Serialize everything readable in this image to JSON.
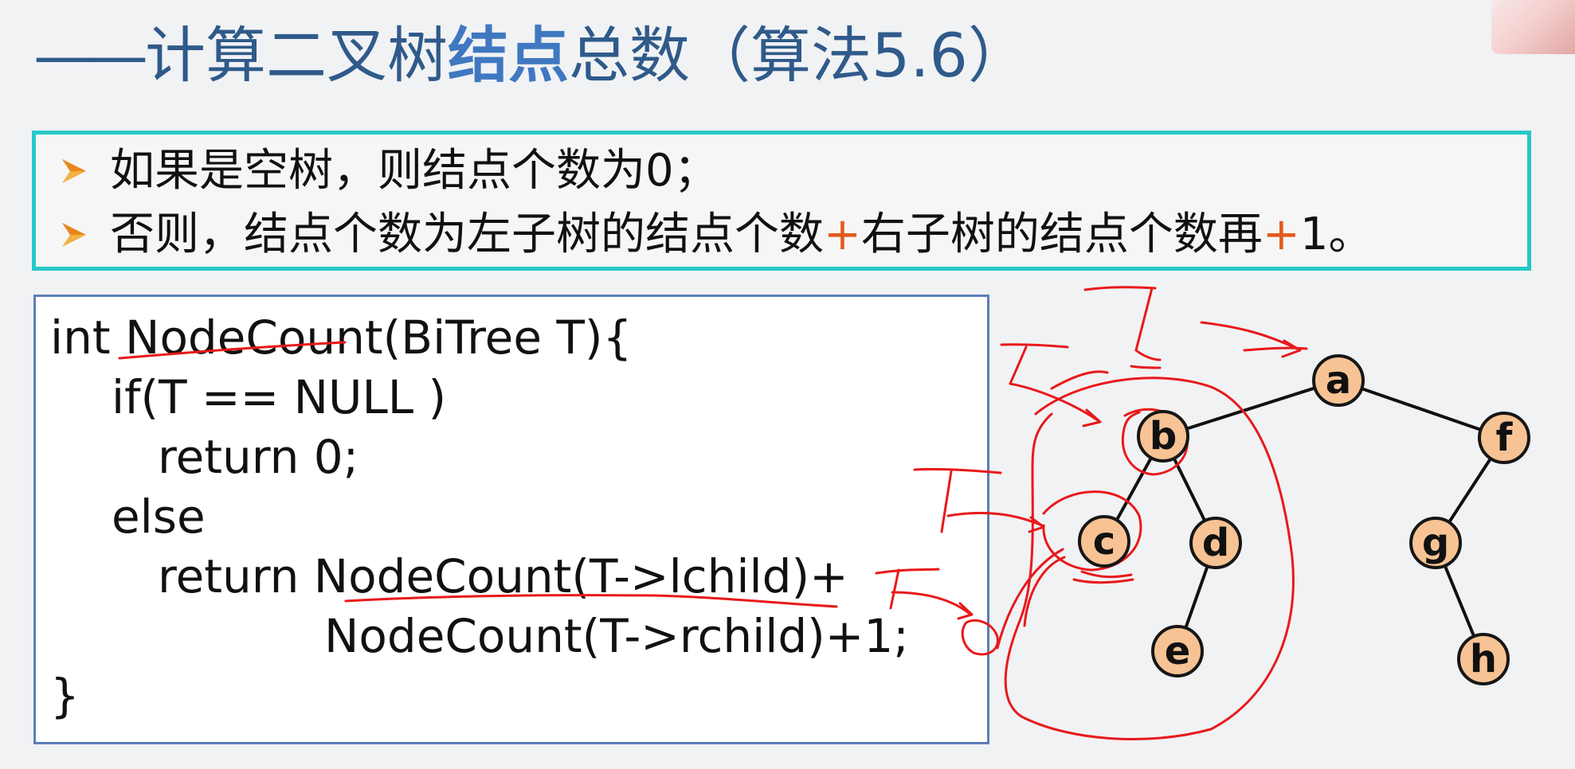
{
  "title": {
    "dash": "——",
    "prefix": "计算二叉树",
    "bold": "结点",
    "suffix": "总数（算法5.6）"
  },
  "rules": {
    "line1": "如果是空树，则结点个数为0；",
    "line2_part1": "否则，结点个数为左子树的结点个数",
    "plus1": "+",
    "line2_part2": "右子树的结点个数再",
    "plus2": "+",
    "line2_part3": "1。"
  },
  "code": {
    "line1": "int NodeCount(BiTree T){",
    "line2": "if(T == NULL )",
    "line3": "return 0;",
    "line4": "else",
    "line5": "return NodeCount(T->lchild)+",
    "line6": "NodeCount(T->rchild)+1;",
    "line7": "}"
  },
  "tree": {
    "nodes": [
      "a",
      "b",
      "f",
      "c",
      "d",
      "g",
      "e",
      "h"
    ]
  },
  "colors": {
    "title_text": "#2f5a8a",
    "title_highlight": "#3f78c1",
    "rule_border": "#28c7c7",
    "plus_sign": "#e25a1f",
    "code_border": "#5a7fb8",
    "node_fill": "#f7c394",
    "annotation_red": "#e8191b"
  },
  "icons": {
    "rule_bullet": "orange-arrowhead-icon"
  }
}
